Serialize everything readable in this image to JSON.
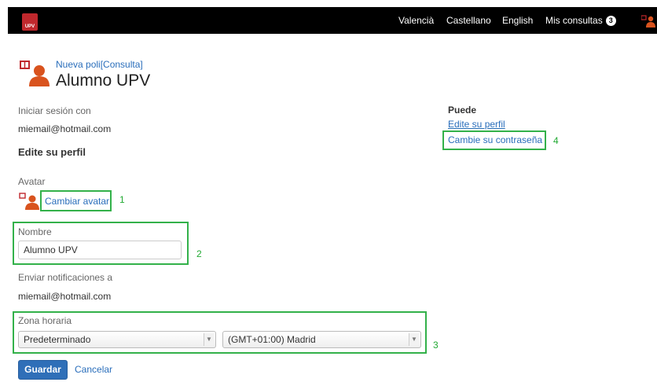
{
  "brand": {
    "logo_text": "UPV",
    "accent": "#c0282d",
    "icon_color": "#d9531e"
  },
  "topbar": {
    "languages": [
      "Valencià",
      "Castellano",
      "English"
    ],
    "consultas_label": "Mis consultas",
    "consultas_count": "3",
    "user_icon": "user-icon"
  },
  "header": {
    "context_link": "Nueva poli[Consulta]",
    "user_name": "Alumno UPV"
  },
  "login": {
    "label": "Iniciar sesión con",
    "email": "miemail@hotmail.com"
  },
  "section_title": "Edite su perfil",
  "avatar": {
    "label": "Avatar",
    "change_link": "Cambiar avatar",
    "annotation": "1"
  },
  "name_field": {
    "label": "Nombre",
    "value": "Alumno UPV",
    "annotation": "2"
  },
  "notifications": {
    "label": "Enviar notificaciones a",
    "email": "miemail@hotmail.com"
  },
  "timezone": {
    "label": "Zona horaria",
    "mode_selected": "Predeterminado",
    "zone_selected": "(GMT+01:00) Madrid",
    "annotation": "3"
  },
  "actions": {
    "save": "Guardar",
    "cancel": "Cancelar"
  },
  "sidebar": {
    "title": "Puede",
    "edit_profile": "Edite su perfil",
    "change_password": "Cambie su contraseña",
    "annotation": "4"
  },
  "highlight_color": "#33b14a"
}
